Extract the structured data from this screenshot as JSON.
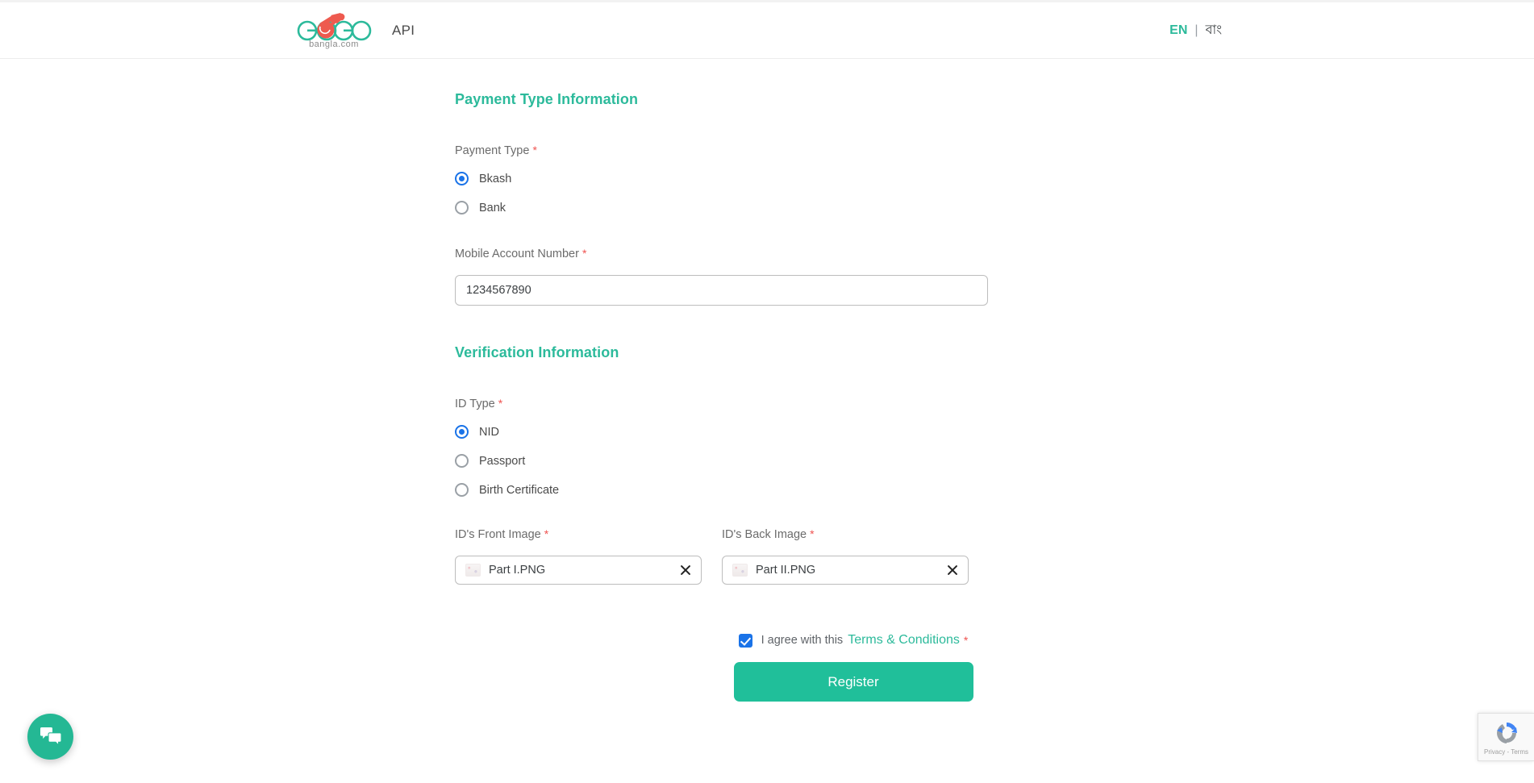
{
  "header": {
    "logo_text_left": "G",
    "logo_text_right": "GO",
    "logo_subtitle": "bangla.com",
    "api_label": "API",
    "lang_en": "EN",
    "lang_separator": "|",
    "lang_bn": "বাং",
    "accent_color": "#2cba9b",
    "logo_red": "#ef5350"
  },
  "payment_section": {
    "title": "Payment Type Information",
    "payment_type_label": "Payment Type",
    "required_mark": "*",
    "options": [
      {
        "label": "Bkash",
        "selected": true
      },
      {
        "label": "Bank",
        "selected": false
      }
    ],
    "mobile_label": "Mobile Account Number",
    "mobile_value": "1234567890",
    "mobile_placeholder": "Mobile Account Number"
  },
  "verification_section": {
    "title": "Verification Information",
    "id_type_label": "ID Type",
    "required_mark": "*",
    "options": [
      {
        "label": "NID",
        "selected": true
      },
      {
        "label": "Passport",
        "selected": false
      },
      {
        "label": "Birth Certificate",
        "selected": false
      }
    ],
    "front_label": "ID's Front Image",
    "front_file": "Part I.PNG",
    "back_label": "ID's Back Image",
    "back_file": "Part II.PNG"
  },
  "footer": {
    "agree_text": "I agree with this",
    "terms_link": "Terms & Conditions",
    "required_mark": "*",
    "agree_checked": true,
    "submit_label": "Register"
  },
  "widgets": {
    "chat_icon": "chat-bubbles-icon",
    "recaptcha_text": "Privacy - Terms",
    "recaptcha_icon": "recaptcha-icon"
  },
  "colors": {
    "brand_teal": "#2cba9b",
    "button_teal": "#20bf9a",
    "radio_blue": "#1a73e8",
    "required_red": "#ef5350"
  }
}
